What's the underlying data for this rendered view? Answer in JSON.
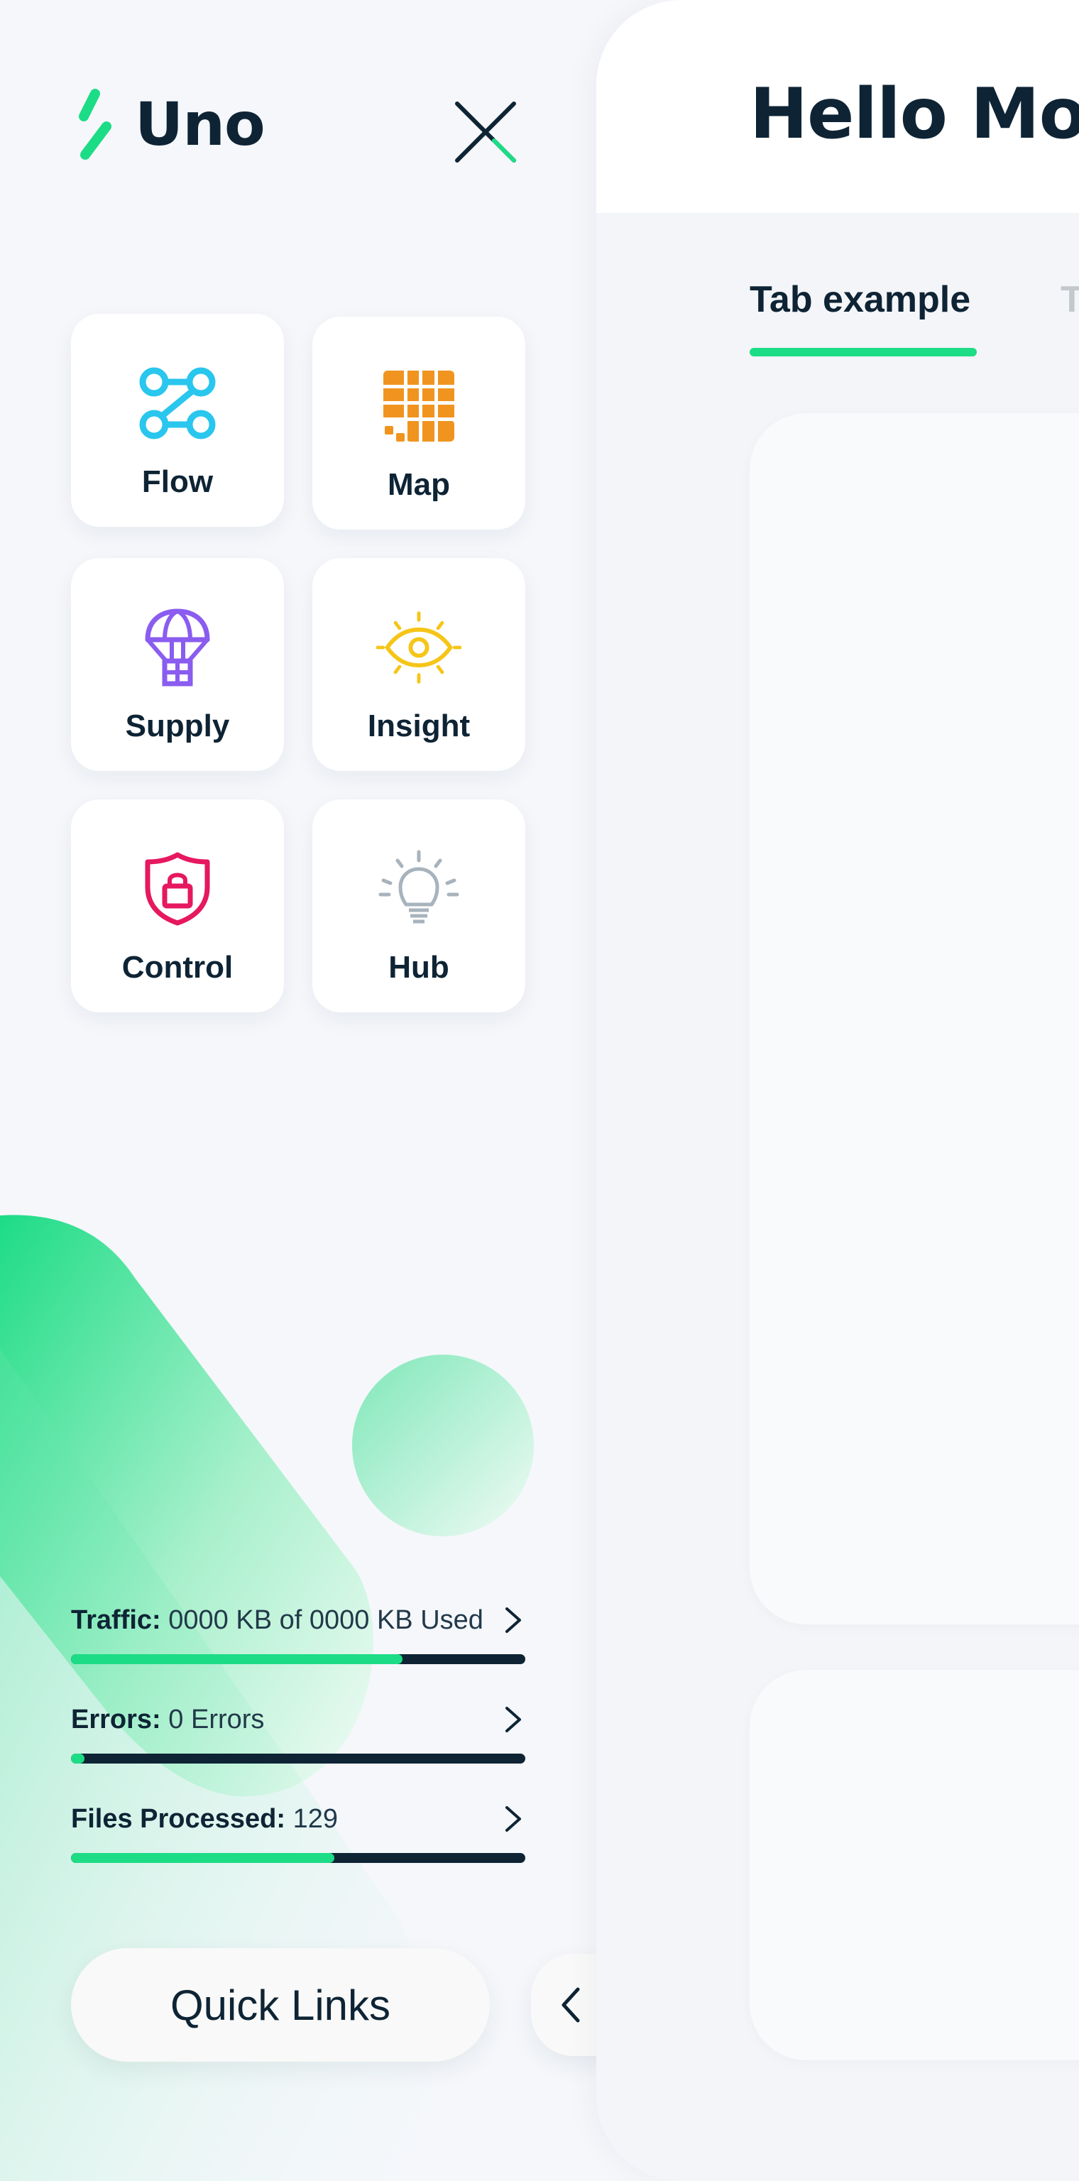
{
  "app": {
    "name": "Uno"
  },
  "header": {
    "title": "Hello Mot"
  },
  "tabs": [
    {
      "label": "Tab example",
      "active": true
    },
    {
      "label": "T",
      "active": false
    }
  ],
  "modules": [
    {
      "label": "Flow",
      "icon": "flow-icon",
      "color": "#29c6ee"
    },
    {
      "label": "Map",
      "icon": "map-grid-icon",
      "color": "#f0941f"
    },
    {
      "label": "Supply",
      "icon": "parachute-icon",
      "color": "#8a5cf0"
    },
    {
      "label": "Insight",
      "icon": "eye-icon",
      "color": "#f5c518"
    },
    {
      "label": "Control",
      "icon": "shield-lock-icon",
      "color": "#e6185f"
    },
    {
      "label": "Hub",
      "icon": "lightbulb-icon",
      "color": "#a7b3bd"
    }
  ],
  "stats": [
    {
      "label": "Traffic:",
      "value": "0000 KB of 0000 KB Used",
      "progress": 0.73
    },
    {
      "label": "Errors:",
      "value": "0 Errors",
      "progress": 0.03
    },
    {
      "label": "Files Processed:",
      "value": "129",
      "progress": 0.58
    }
  ],
  "quick_links": {
    "label": "Quick Links"
  },
  "colors": {
    "accent": "#1ddc86",
    "text": "#0e2435",
    "background": "#f5f7fb"
  }
}
